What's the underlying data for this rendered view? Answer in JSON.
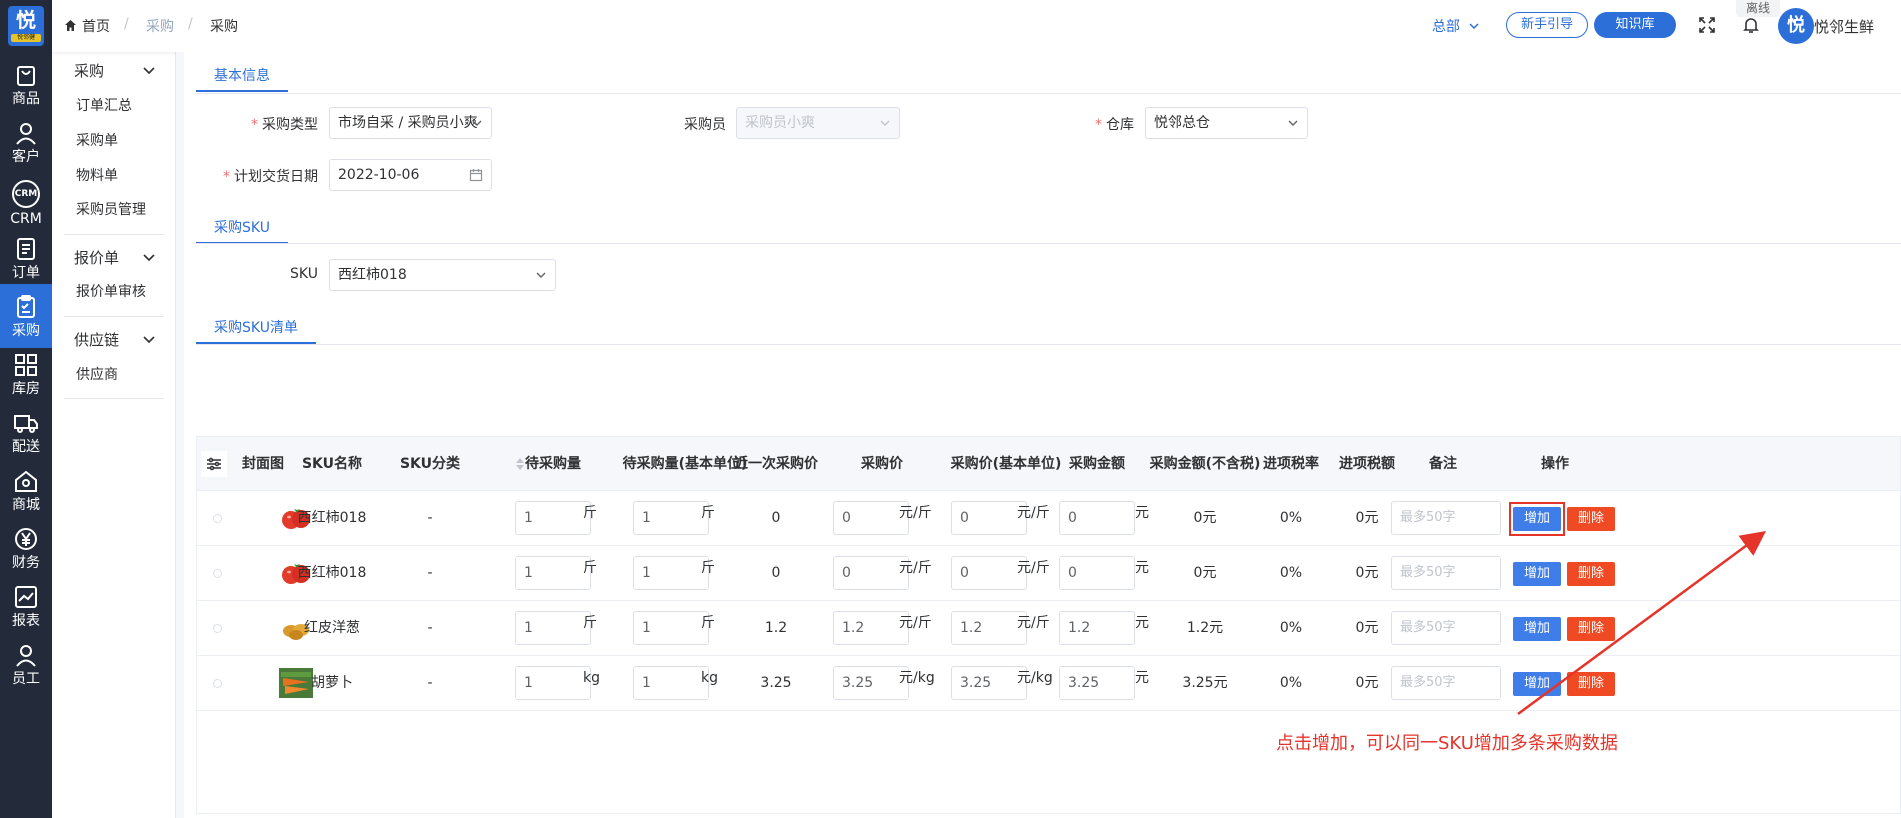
{
  "rail": {
    "logo_char": "悦",
    "logo_sub": "悦邻健",
    "items": [
      {
        "label": "商品",
        "icon": "bag-icon"
      },
      {
        "label": "客户",
        "icon": "user-icon"
      },
      {
        "label": "CRM",
        "icon": "crm-icon"
      },
      {
        "label": "订单",
        "icon": "order-icon"
      },
      {
        "label": "采购",
        "icon": "purchase-icon",
        "active": true
      },
      {
        "label": "库房",
        "icon": "warehouse-icon"
      },
      {
        "label": "配送",
        "icon": "truck-icon"
      },
      {
        "label": "商城",
        "icon": "shop-icon"
      },
      {
        "label": "财务",
        "icon": "yen-icon"
      },
      {
        "label": "报表",
        "icon": "chart-icon"
      },
      {
        "label": "员工",
        "icon": "staff-icon"
      }
    ],
    "crm_text": "CRM"
  },
  "submenu": {
    "groups": [
      {
        "title": "采购",
        "items": [
          "订单汇总",
          "采购单",
          "物料单",
          "采购员管理"
        ]
      },
      {
        "title": "报价单",
        "items": [
          "报价单审核"
        ]
      },
      {
        "title": "供应链",
        "items": [
          "供应商"
        ]
      }
    ]
  },
  "header": {
    "breadcrumb": [
      "首页",
      "采购",
      "采购"
    ],
    "separator": "/",
    "hq_label": "总部",
    "guide_btn": "新手引导",
    "kb_btn": "知识库",
    "offline_badge": "离线",
    "avatar_char": "悦",
    "user_name": "悦邻生鲜"
  },
  "basic": {
    "tab": "基本信息",
    "type_label": "采购类型",
    "type_value": "市场自采 / 采购员小爽",
    "buyer_label": "采购员",
    "buyer_value": "采购员小爽",
    "warehouse_label": "仓库",
    "warehouse_value": "悦邻总仓",
    "date_label": "计划交货日期",
    "date_value": "2022-10-06",
    "required_mark": "*"
  },
  "sku": {
    "tab": "采购SKU",
    "label": "SKU",
    "value": "西红柿018"
  },
  "list": {
    "tab": "采购SKU清单",
    "columns": [
      "封面图",
      "SKU名称",
      "SKU分类",
      "待采购量",
      "待采购量(基本单位)",
      "近一次采购价",
      "采购价",
      "采购价(基本单位)",
      "采购金额",
      "采购金额(不含税)",
      "进项税率",
      "进项税额",
      "备注",
      "操作"
    ],
    "remark_placeholder": "最多50字",
    "add_label": "增加",
    "delete_label": "删除",
    "rows": [
      {
        "name": "西红柿018",
        "thumb": "tomato",
        "category": "-",
        "qty": "1",
        "qty_unit": "斤",
        "base_qty": "1",
        "base_unit": "斤",
        "last_price": "0",
        "price": "0",
        "price_unit": "元/斤",
        "base_price": "0",
        "base_price_unit": "元/斤",
        "amount": "0",
        "amount_unit": "元",
        "amount_ex": "0元",
        "tax_rate": "0%",
        "tax": "0元",
        "highlighted": true
      },
      {
        "name": "西红柿018",
        "thumb": "tomato",
        "category": "-",
        "qty": "1",
        "qty_unit": "斤",
        "base_qty": "1",
        "base_unit": "斤",
        "last_price": "0",
        "price": "0",
        "price_unit": "元/斤",
        "base_price": "0",
        "base_price_unit": "元/斤",
        "amount": "0",
        "amount_unit": "元",
        "amount_ex": "0元",
        "tax_rate": "0%",
        "tax": "0元"
      },
      {
        "name": "红皮洋葱",
        "thumb": "onion",
        "category": "-",
        "qty": "1",
        "qty_unit": "斤",
        "base_qty": "1",
        "base_unit": "斤",
        "last_price": "1.2",
        "price": "1.2",
        "price_unit": "元/斤",
        "base_price": "1.2",
        "base_price_unit": "元/斤",
        "amount": "1.2",
        "amount_unit": "元",
        "amount_ex": "1.2元",
        "tax_rate": "0%",
        "tax": "0元"
      },
      {
        "name": "胡萝卜",
        "thumb": "carrot",
        "category": "-",
        "qty": "1",
        "qty_unit": "kg",
        "base_qty": "1",
        "base_unit": "kg",
        "last_price": "3.25",
        "price": "3.25",
        "price_unit": "元/kg",
        "base_price": "3.25",
        "base_price_unit": "元/kg",
        "amount": "3.25",
        "amount_unit": "元",
        "amount_ex": "3.25元",
        "tax_rate": "0%",
        "tax": "0元"
      }
    ]
  },
  "annotation": {
    "text": "点击增加，可以同一SKU增加多条采购数据",
    "color": "#e5342a"
  },
  "colors": {
    "brand": "#2d6fd9",
    "rail_bg": "#232b3b",
    "add_btn": "#3f7de8",
    "delete_btn": "#f04a24"
  }
}
